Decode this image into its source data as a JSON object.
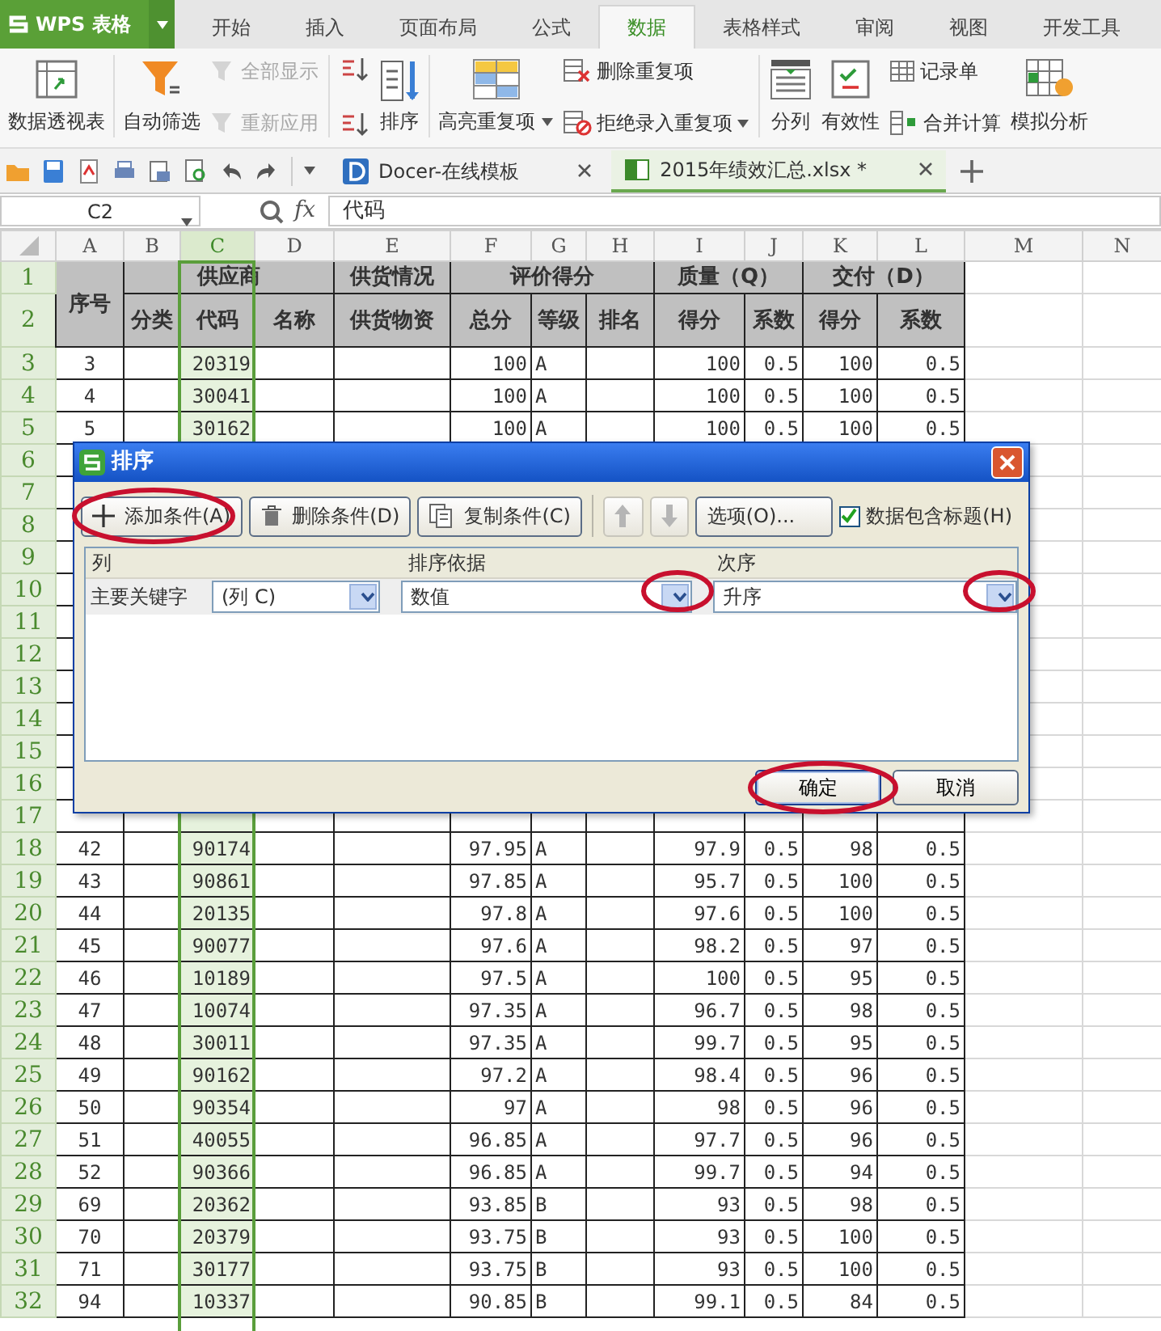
{
  "app": {
    "logo": "WPS 表格"
  },
  "ribbon_tabs": [
    {
      "label": "开始",
      "selected": false
    },
    {
      "label": "插入",
      "selected": false
    },
    {
      "label": "页面布局",
      "selected": false
    },
    {
      "label": "公式",
      "selected": false
    },
    {
      "label": "数据",
      "selected": true
    },
    {
      "label": "表格样式",
      "selected": false
    },
    {
      "label": "审阅",
      "selected": false
    },
    {
      "label": "视图",
      "selected": false
    },
    {
      "label": "开发工具",
      "selected": false
    }
  ],
  "ribbon_groups": [
    {
      "columns": [
        {
          "kind": "large",
          "label": "数据透视表"
        }
      ]
    },
    {
      "columns": [
        {
          "kind": "large",
          "label": "自动筛选"
        },
        {
          "kind": "stack",
          "items": [
            {
              "label": "全部显示",
              "disabled": true
            },
            {
              "label": "重新应用",
              "disabled": true
            }
          ]
        }
      ]
    },
    {
      "columns": [
        {
          "kind": "stack",
          "items": [
            {
              "disabled": false
            },
            {
              "disabled": false
            }
          ]
        },
        {
          "kind": "large",
          "label": "排序"
        }
      ]
    },
    {
      "columns": [
        {
          "kind": "large",
          "label": "高亮重复项",
          "dropdown": true
        },
        {
          "kind": "stack",
          "items": [
            {
              "label": "删除重复项",
              "disabled": false
            },
            {
              "label": "拒绝录入重复项",
              "disabled": false,
              "dropdown": true
            }
          ]
        }
      ]
    },
    {
      "columns": [
        {
          "kind": "large",
          "label": "分列"
        },
        {
          "kind": "large",
          "label": "有效性"
        },
        {
          "kind": "stack",
          "items": [
            {
              "label": "记录单",
              "disabled": false
            },
            {
              "label": "合并计算",
              "disabled": false
            }
          ]
        },
        {
          "kind": "large",
          "label": "模拟分析"
        }
      ]
    }
  ],
  "doc_tabs": [
    {
      "label": "Docer-在线模板",
      "selected": false
    },
    {
      "label": "2015年绩效汇总.xlsx *",
      "selected": true
    }
  ],
  "formula_bar": {
    "name_box": "C2",
    "fx": "fx",
    "value": "代码"
  },
  "sheet": {
    "columns": [
      {
        "label": "A",
        "selected": false
      },
      {
        "label": "B",
        "selected": false
      },
      {
        "label": "C",
        "selected": true
      },
      {
        "label": "D",
        "selected": false
      },
      {
        "label": "E",
        "selected": false
      },
      {
        "label": "F",
        "selected": false
      },
      {
        "label": "G",
        "selected": false
      },
      {
        "label": "H",
        "selected": false
      },
      {
        "label": "I",
        "selected": false
      },
      {
        "label": "J",
        "selected": false
      },
      {
        "label": "K",
        "selected": false
      },
      {
        "label": "L",
        "selected": false
      },
      {
        "label": "M",
        "selected": false
      },
      {
        "label": "N",
        "selected": false
      }
    ],
    "header_row1": [
      "序号",
      "供应商",
      "供货情况",
      "评价得分",
      "质量（Q）",
      "交付（D）"
    ],
    "header_row2": [
      "分类",
      "代码",
      "名称",
      "供货物资",
      "总分",
      "等级",
      "排名",
      "得分",
      "系数",
      "得分",
      "系数"
    ],
    "rows": [
      {
        "number": "1"
      },
      {
        "number": "2"
      },
      {
        "number": "3",
        "cells": [
          "3",
          "20319",
          "100",
          "A",
          "100",
          "0.5",
          "100",
          "0.5"
        ]
      },
      {
        "number": "4",
        "cells": [
          "4",
          "30041",
          "100",
          "A",
          "100",
          "0.5",
          "100",
          "0.5"
        ]
      },
      {
        "number": "5",
        "cells": [
          "5",
          "30162",
          "100",
          "A",
          "100",
          "0.5",
          "100",
          "0.5"
        ]
      },
      {
        "number": "6"
      },
      {
        "number": "7"
      },
      {
        "number": "8"
      },
      {
        "number": "9"
      },
      {
        "number": "10"
      },
      {
        "number": "11"
      },
      {
        "number": "12"
      },
      {
        "number": "13"
      },
      {
        "number": "14"
      },
      {
        "number": "15"
      },
      {
        "number": "16"
      },
      {
        "number": "17"
      },
      {
        "number": "18",
        "cells": [
          "42",
          "90174",
          "97.95",
          "A",
          "97.9",
          "0.5",
          "98",
          "0.5"
        ]
      },
      {
        "number": "19",
        "cells": [
          "43",
          "90861",
          "97.85",
          "A",
          "95.7",
          "0.5",
          "100",
          "0.5"
        ]
      },
      {
        "number": "20",
        "cells": [
          "44",
          "20135",
          "97.8",
          "A",
          "97.6",
          "0.5",
          "100",
          "0.5"
        ]
      },
      {
        "number": "21",
        "cells": [
          "45",
          "90077",
          "97.6",
          "A",
          "98.2",
          "0.5",
          "97",
          "0.5"
        ]
      },
      {
        "number": "22",
        "cells": [
          "46",
          "10189",
          "97.5",
          "A",
          "100",
          "0.5",
          "95",
          "0.5"
        ]
      },
      {
        "number": "23",
        "cells": [
          "47",
          "10074",
          "97.35",
          "A",
          "96.7",
          "0.5",
          "98",
          "0.5"
        ]
      },
      {
        "number": "24",
        "cells": [
          "48",
          "30011",
          "97.35",
          "A",
          "99.7",
          "0.5",
          "95",
          "0.5"
        ]
      },
      {
        "number": "25",
        "cells": [
          "49",
          "90162",
          "97.2",
          "A",
          "98.4",
          "0.5",
          "96",
          "0.5"
        ]
      },
      {
        "number": "26",
        "cells": [
          "50",
          "90354",
          "97",
          "A",
          "98",
          "0.5",
          "96",
          "0.5"
        ]
      },
      {
        "number": "27",
        "cells": [
          "51",
          "40055",
          "96.85",
          "A",
          "97.7",
          "0.5",
          "96",
          "0.5"
        ]
      },
      {
        "number": "28",
        "cells": [
          "52",
          "90366",
          "96.85",
          "A",
          "99.7",
          "0.5",
          "94",
          "0.5"
        ]
      },
      {
        "number": "29",
        "cells": [
          "69",
          "20362",
          "93.85",
          "B",
          "93",
          "0.5",
          "98",
          "0.5"
        ]
      },
      {
        "number": "30",
        "cells": [
          "70",
          "20379",
          "93.75",
          "B",
          "93",
          "0.5",
          "100",
          "0.5"
        ]
      },
      {
        "number": "31",
        "cells": [
          "71",
          "30177",
          "93.75",
          "B",
          "93",
          "0.5",
          "100",
          "0.5"
        ]
      },
      {
        "number": "32",
        "cells": [
          "94",
          "10337",
          "90.85",
          "B",
          "99.1",
          "0.5",
          "84",
          "0.5"
        ]
      }
    ]
  },
  "dialog": {
    "title": "排序",
    "toolbar": [
      {
        "kind": "add",
        "label": "添加条件(A)",
        "disabled": false
      },
      {
        "kind": "delete",
        "label": "删除条件(D)",
        "disabled": false
      },
      {
        "kind": "copy",
        "label": "复制条件(C)",
        "disabled": false
      },
      {
        "kind": "up",
        "disabled": true
      },
      {
        "kind": "down",
        "disabled": true
      },
      {
        "kind": "plain",
        "label": "选项(O)...",
        "disabled": false
      }
    ],
    "has_header": {
      "label": "数据包含标题(H)",
      "checked": true
    },
    "columns": [
      "列",
      "排序依据",
      "次序"
    ],
    "rows": [
      {
        "label": "主要关键字",
        "column": "(列 C)",
        "basis": "数值",
        "order": "升序"
      }
    ],
    "buttons": [
      {
        "label": "确定",
        "default": true
      },
      {
        "label": "取消",
        "default": false
      }
    ]
  }
}
